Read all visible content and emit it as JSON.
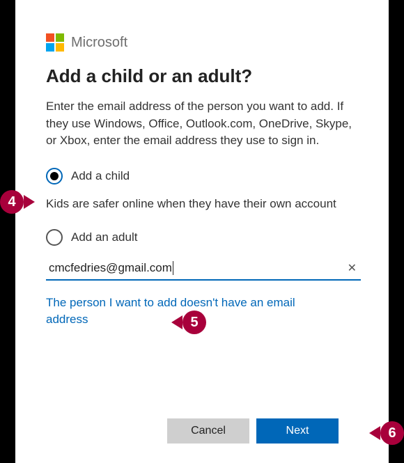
{
  "brand": {
    "name": "Microsoft"
  },
  "title": "Add a child or an adult?",
  "instructions": "Enter the email address of the person you want to add. If they use Windows, Office, Outlook.com, OneDrive, Skype, or Xbox, enter the email address they use to sign in.",
  "radios": {
    "child": {
      "label": "Add a child",
      "selected": true
    },
    "adult": {
      "label": "Add an adult",
      "selected": false
    }
  },
  "child_hint": "Kids are safer online when they have their own account",
  "email": {
    "value": "cmcfedries@gmail.com",
    "placeholder": "Email address"
  },
  "link_no_email": "The person I want to add doesn't have an email address",
  "buttons": {
    "cancel": "Cancel",
    "next": "Next"
  },
  "callouts": {
    "c4": "4",
    "c5": "5",
    "c6": "6"
  },
  "colors": {
    "accent": "#0067b8",
    "callout": "#a8003b"
  }
}
